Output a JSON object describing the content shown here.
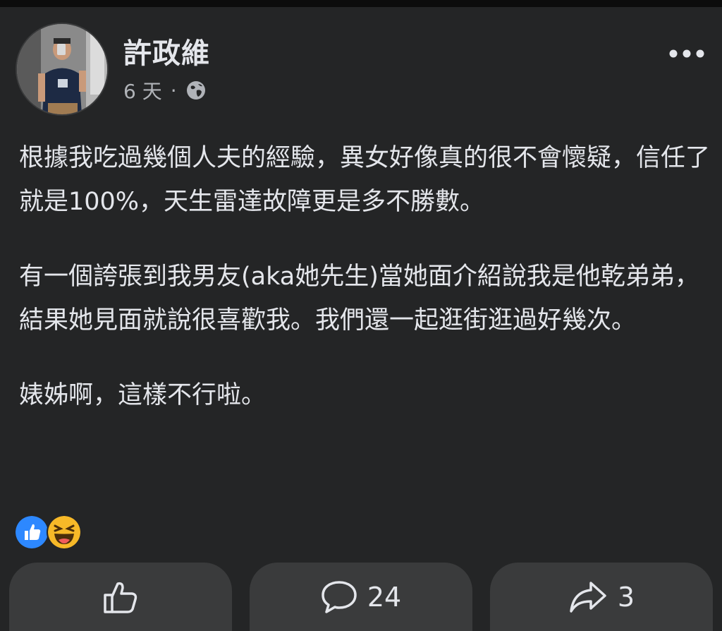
{
  "post": {
    "author": "許政維",
    "time": "6 天",
    "separator": "·",
    "privacy_icon": "globe-icon",
    "paragraphs": [
      "根據我吃過幾個人夫的經驗，異女好像真的很不會懷疑，信任了就是100%，天生雷達故障更是多不勝數。",
      "有一個誇張到我男友(aka她先生)當她面介紹說我是他乾弟弟，結果她見面就說很喜歡我。我們還一起逛街逛過好幾次。",
      "婊姊啊，這樣不行啦。"
    ]
  },
  "reactions": {
    "icons": [
      "like-reaction-icon",
      "haha-reaction-icon"
    ]
  },
  "actions": {
    "like_icon": "thumbs-up-icon",
    "comment_icon": "comment-bubble-icon",
    "comment_count": "24",
    "share_icon": "share-arrow-icon",
    "share_count": "3"
  },
  "colors": {
    "background": "#242526",
    "button_background": "#3a3b3c",
    "primary_text": "#e4e6eb",
    "secondary_text": "#b0b3b8",
    "like_blue": "#2d88ff",
    "haha_yellow": "#f7b928"
  }
}
